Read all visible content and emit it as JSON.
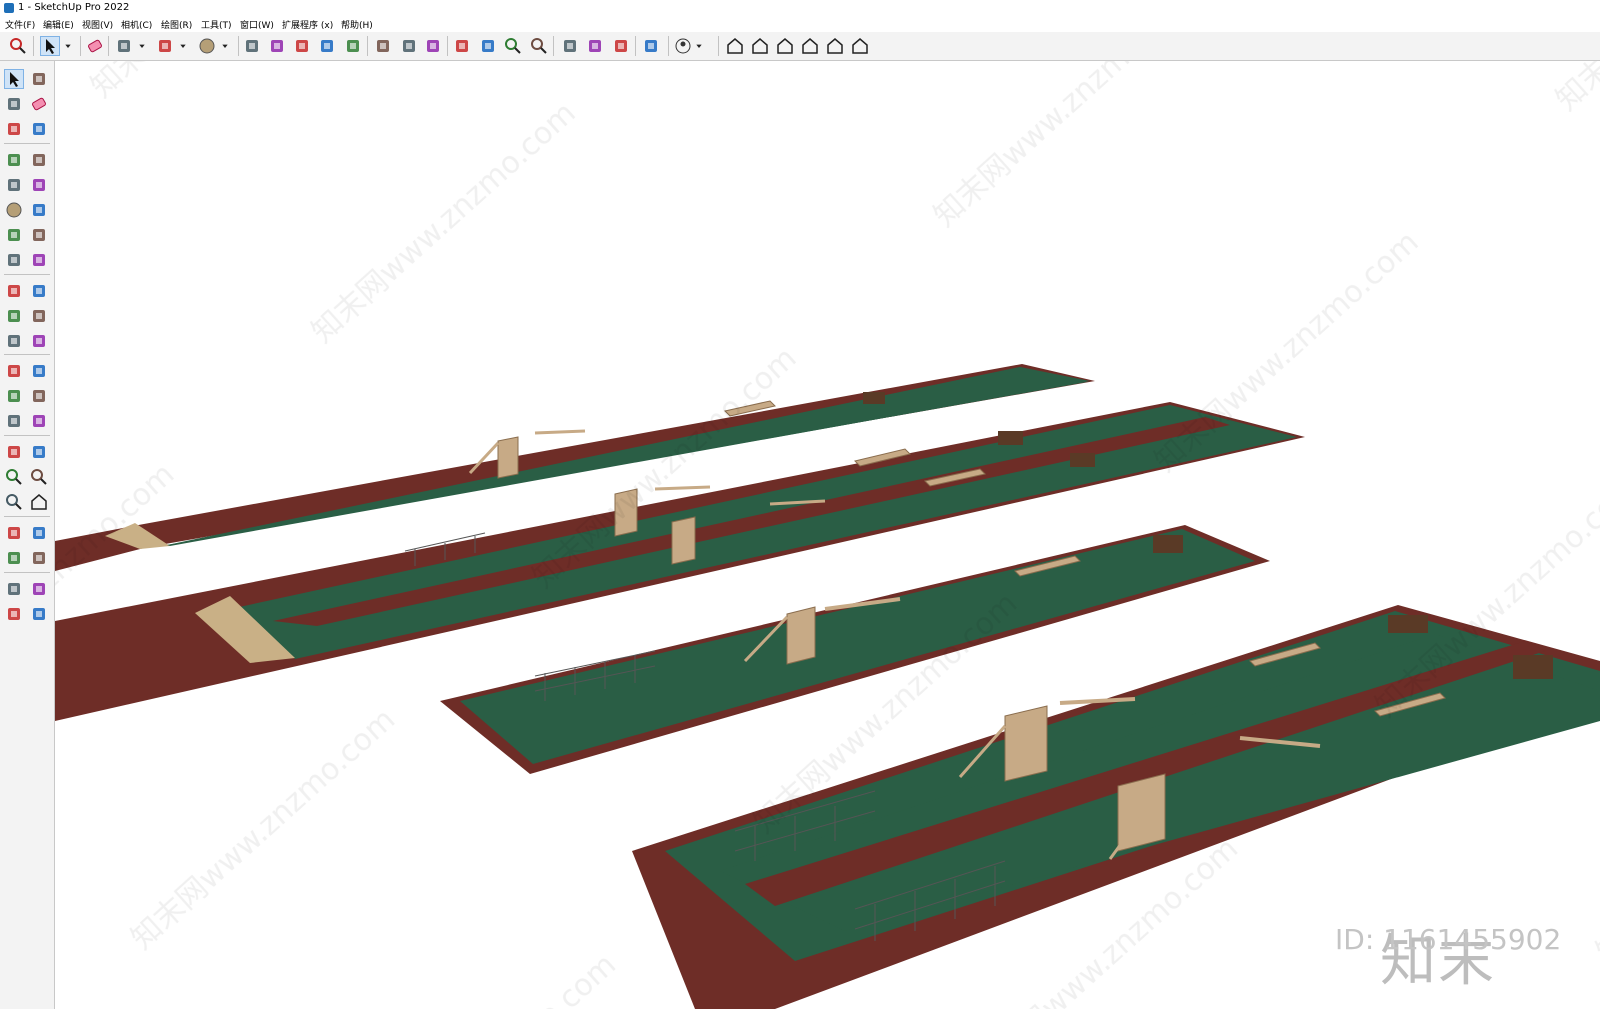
{
  "window": {
    "title": "1 - SketchUp Pro 2022"
  },
  "menu": [
    {
      "label": "文件(F)"
    },
    {
      "label": "编辑(E)"
    },
    {
      "label": "视图(V)"
    },
    {
      "label": "相机(C)"
    },
    {
      "label": "绘图(R)"
    },
    {
      "label": "工具(T)"
    },
    {
      "label": "窗口(W)"
    },
    {
      "label": "扩展程序 (x)"
    },
    {
      "label": "帮助(H)"
    }
  ],
  "toolbar_icons": [
    "search-icon",
    "select-icon",
    "dropdown-icon",
    "eraser-icon",
    "pencil-icon",
    "dropdown-icon",
    "arc-icon",
    "dropdown-icon",
    "circle-icon",
    "dropdown-icon",
    "push-pull-icon",
    "follow-me-icon",
    "move-icon",
    "rotate-icon",
    "scale-icon",
    "tape-measure-icon",
    "text-icon",
    "paint-bucket-icon",
    "orbit-icon",
    "pan-icon",
    "zoom-icon",
    "zoom-extents-icon",
    "warehouse-icon",
    "sandbox-icon",
    "layers-icon",
    "extension-icon",
    "user-icon",
    "dropdown-icon",
    "iso-view-icon",
    "front-view-icon",
    "home-view-icon",
    "right-view-icon",
    "back-view-icon",
    "left-view-icon"
  ],
  "left_tool_icons": [
    "select-icon",
    "orbit-small-icon",
    "paint-bucket-icon",
    "eraser-icon",
    "component-icon",
    "tag-icon",
    "line-icon",
    "freehand-icon",
    "rectangle-icon",
    "rotated-rectangle-icon",
    "circle-icon",
    "polygon-icon",
    "arc-icon",
    "two-point-arc-icon",
    "three-point-arc-icon",
    "pie-icon",
    "move-icon",
    "push-pull-icon",
    "rotate-icon",
    "follow-me-icon",
    "scale-icon",
    "offset-icon",
    "tape-measure-icon",
    "dimension-icon",
    "protractor-icon",
    "text-icon",
    "axes-icon",
    "3d-text-icon",
    "orbit-icon",
    "pan-icon",
    "zoom-icon",
    "zoom-window-icon",
    "zoom-extents-icon",
    "previous-view-icon",
    "position-camera-icon",
    "look-around-icon",
    "walk-icon",
    "section-plane-icon",
    "warehouse-icon",
    "sandbox-icon",
    "layers-icon",
    "extension-icon"
  ],
  "colors": {
    "field_green": "#2a5e45",
    "track_red": "#6e2d27",
    "wood": "#c7aa86",
    "dark_wood": "#5a3a26",
    "sand": "#c9b086"
  },
  "watermark": {
    "logo": "知末",
    "id": "ID: 1161455902",
    "site": "www.znzmo.com"
  }
}
